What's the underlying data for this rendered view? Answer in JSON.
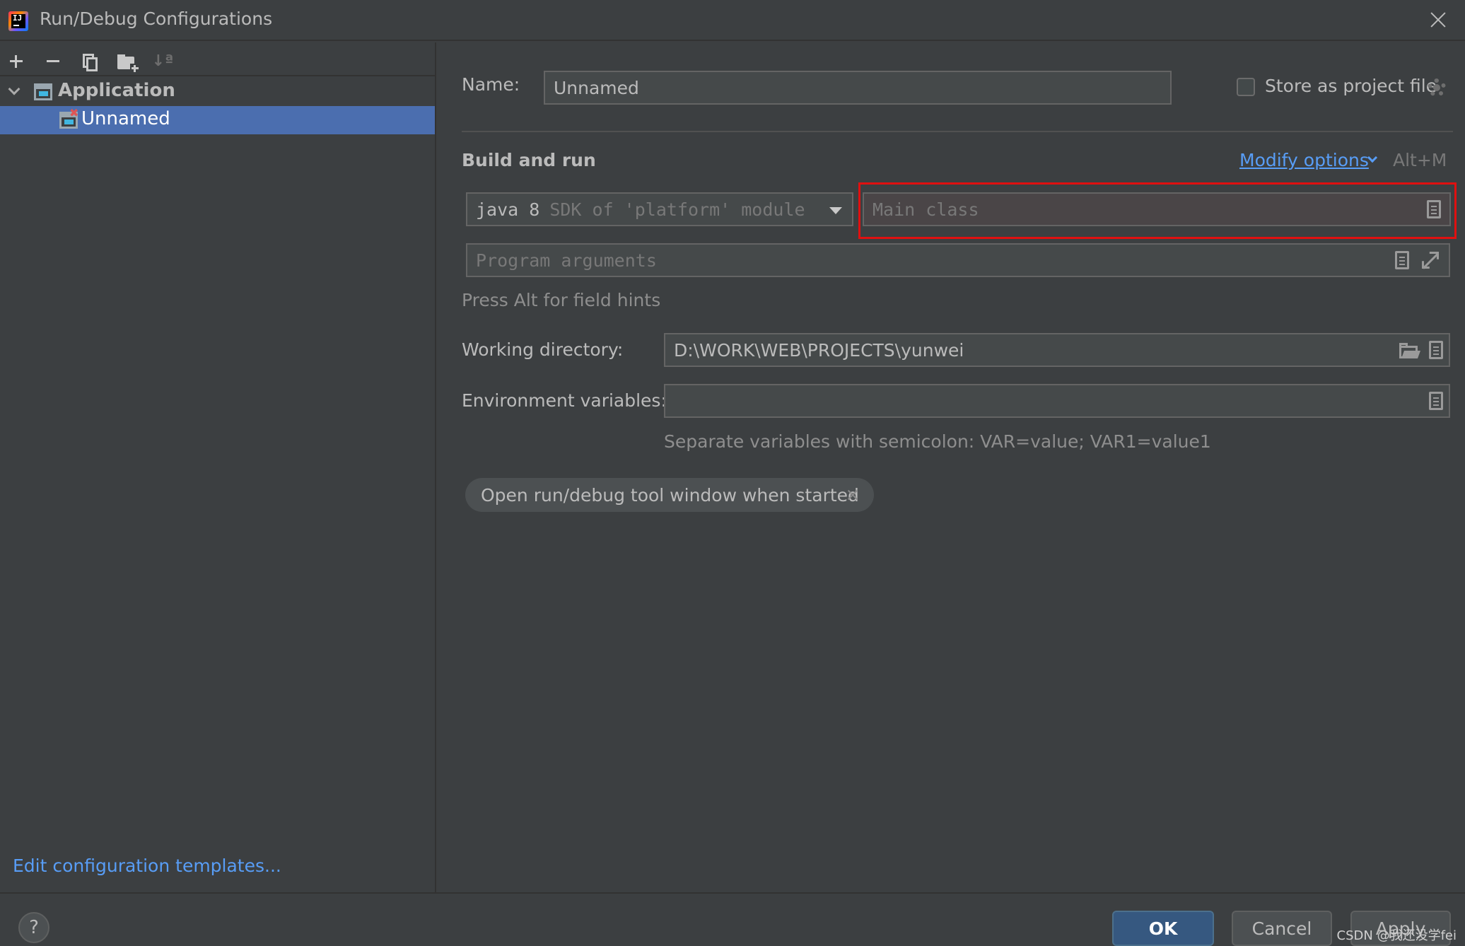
{
  "window": {
    "title": "Run/Debug Configurations",
    "logo_text": "IJ"
  },
  "sidebar": {
    "toolbar": [
      "add-icon",
      "remove-icon",
      "copy-icon",
      "new-folder-icon",
      "sort-icon"
    ],
    "sort_label": "↓ª",
    "tree": [
      {
        "label": "Application",
        "expanded": true,
        "bold": true
      },
      {
        "label": "Unnamed",
        "selected": true,
        "error_mark": "✖"
      }
    ],
    "edit_templates": "Edit configuration templates..."
  },
  "form": {
    "name_label": "Name:",
    "name_value": "Unnamed",
    "store_label": "Store as project file",
    "store_checked": false,
    "section_title": "Build and run",
    "modify_options": "Modify options",
    "modify_shortcut": "Alt+M",
    "jdk_main": "java 8",
    "jdk_suffix": "SDK of 'platform' module",
    "main_class_placeholder": "Main class",
    "program_args_placeholder": "Program arguments",
    "field_hints": "Press Alt for field hints",
    "workdir_label": "Working directory:",
    "workdir_value": "D:\\WORK\\WEB\\PROJECTS\\yunwei",
    "env_label": "Environment variables:",
    "env_value": "",
    "env_hint": "Separate variables with semicolon: VAR=value; VAR1=value1",
    "chip_label": "Open run/debug tool window when started"
  },
  "buttons": {
    "help": "?",
    "ok": "OK",
    "cancel": "Cancel",
    "apply": "Apply"
  },
  "watermark": "CSDN @我还没学fei",
  "colors": {
    "background": "#3c3f41",
    "selection": "#4b6eaf",
    "link": "#589df6",
    "highlight_box": "#e01010",
    "ok_button": "#365880"
  }
}
